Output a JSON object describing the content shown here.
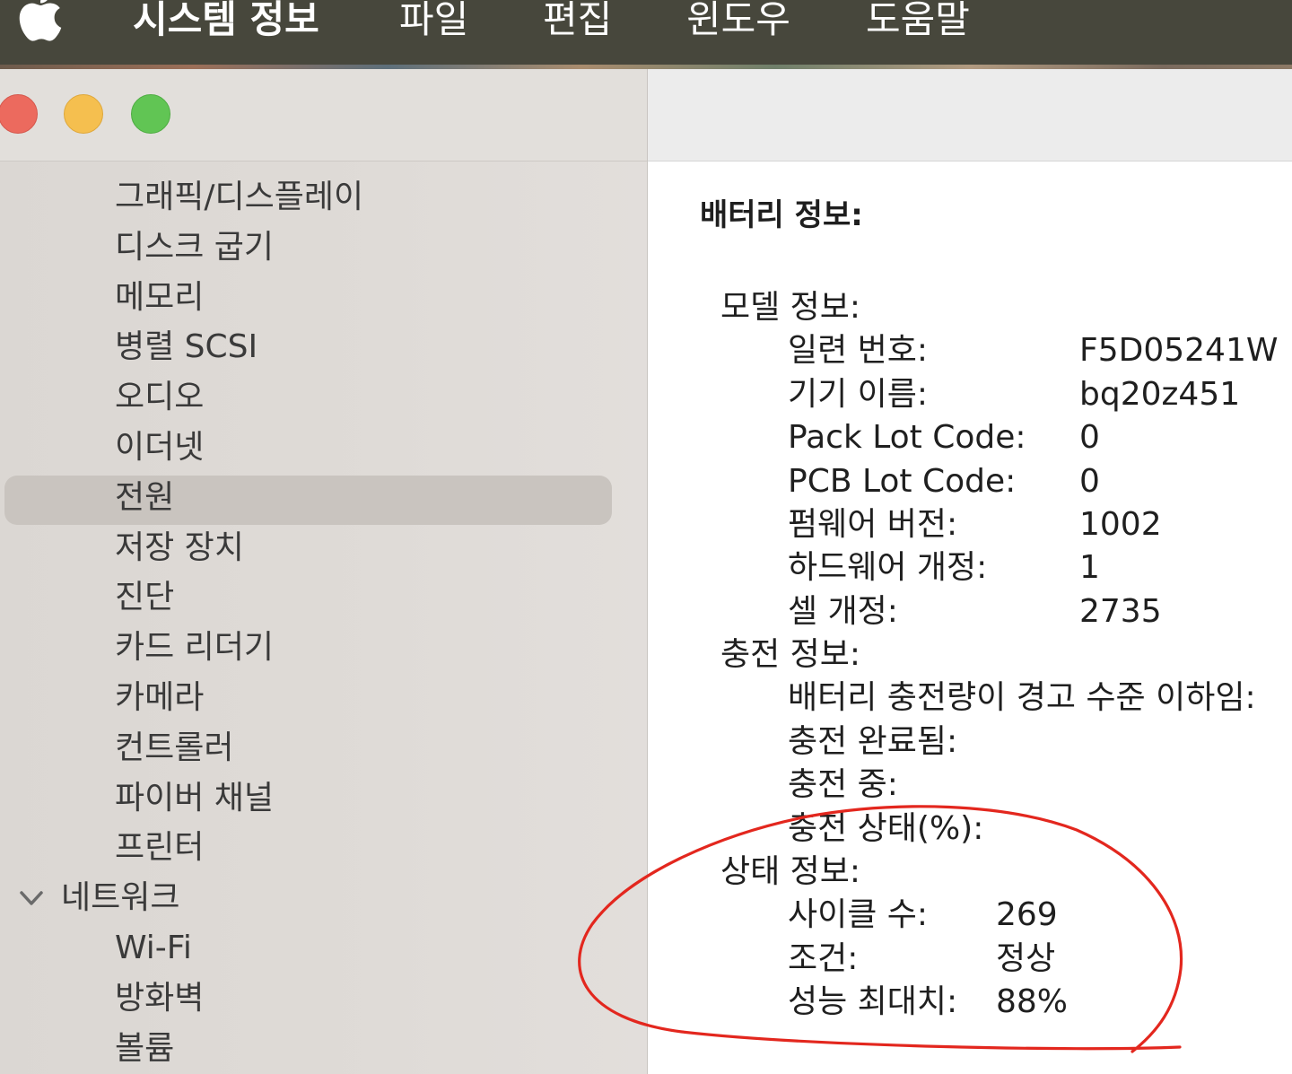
{
  "menubar": {
    "app_name": "시스템 정보",
    "items": [
      "파일",
      "편집",
      "윈도우",
      "도움말"
    ],
    "apple_icon": "apple-logo-icon"
  },
  "sidebar": {
    "items": [
      "그래픽/디스플레이",
      "디스크 굽기",
      "메모리",
      "병렬 SCSI",
      "오디오",
      "이더넷",
      "전원",
      "저장 장치",
      "진단",
      "카드 리더기",
      "카메라",
      "컨트롤러",
      "파이버 채널",
      "프린터"
    ],
    "selected": "전원",
    "network_group": "네트워크",
    "network_items": [
      "Wi-Fi",
      "방화벽",
      "볼륨"
    ]
  },
  "content": {
    "title": "배터리 정보:",
    "sections": [
      {
        "label": "모델 정보:",
        "rows": [
          {
            "k": "일련 번호:",
            "v": "F5D05241W"
          },
          {
            "k": "기기 이름:",
            "v": "bq20z451"
          },
          {
            "k": "Pack Lot Code:",
            "v": "0"
          },
          {
            "k": "PCB Lot Code:",
            "v": "0"
          },
          {
            "k": "펌웨어 버전:",
            "v": "1002"
          },
          {
            "k": "하드웨어 개정:",
            "v": "1"
          },
          {
            "k": "셀 개정:",
            "v": "2735"
          }
        ]
      },
      {
        "label": "충전 정보:",
        "rows": [
          {
            "k": "배터리 충전량이 경고 수준 이하임:"
          },
          {
            "k": "충전 완료됨:"
          },
          {
            "k": "충전 중:"
          },
          {
            "k": "충전 상태(%):"
          }
        ]
      },
      {
        "label": "상태 정보:",
        "rows": [
          {
            "k": "사이클 수:",
            "v": "269"
          },
          {
            "k": "조건:",
            "v": "정상"
          },
          {
            "k": "성능 최대치:",
            "v": "88%"
          }
        ]
      }
    ]
  },
  "colors": {
    "menubar_bg": "#47473c",
    "traffic_red": "#ec6a5e",
    "traffic_yellow": "#f5bf4f",
    "traffic_green": "#61c554",
    "selection_bg": "#c9c4bf",
    "annotation_red": "#e3271e"
  }
}
